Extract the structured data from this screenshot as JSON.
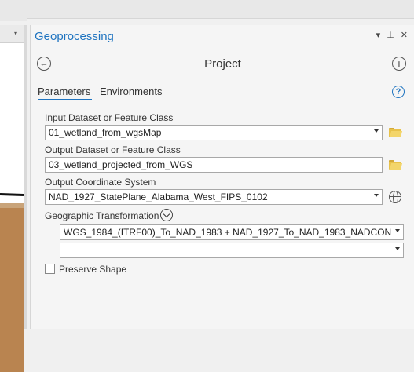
{
  "map": {
    "collapse_arrow": "▾"
  },
  "pane": {
    "title": "Geoprocessing",
    "controls": {
      "menu": "▾",
      "pin": "⊥",
      "close": "✕"
    }
  },
  "tool": {
    "back_glyph": "←",
    "title": "Project",
    "add_glyph": "+"
  },
  "tabs": {
    "parameters": "Parameters",
    "environments": "Environments",
    "help_glyph": "?"
  },
  "params": {
    "input_label": "Input Dataset or Feature Class",
    "input_value": "01_wetland_from_wgsMap",
    "output_label": "Output Dataset or Feature Class",
    "output_value": "03_wetland_projected_from_WGS",
    "coord_label": "Output Coordinate System",
    "coord_value": "NAD_1927_StatePlane_Alabama_West_FIPS_0102",
    "geo_label": "Geographic Transformation",
    "geo_value": "WGS_1984_(ITRF00)_To_NAD_1983 + NAD_1927_To_NAD_1983_NADCON",
    "geo_value2": "",
    "preserve_label": "Preserve Shape",
    "preserve_checked": false
  },
  "colors": {
    "accent": "#1f74c0",
    "folder": "#e8c24a",
    "map_land": "#b98450"
  }
}
